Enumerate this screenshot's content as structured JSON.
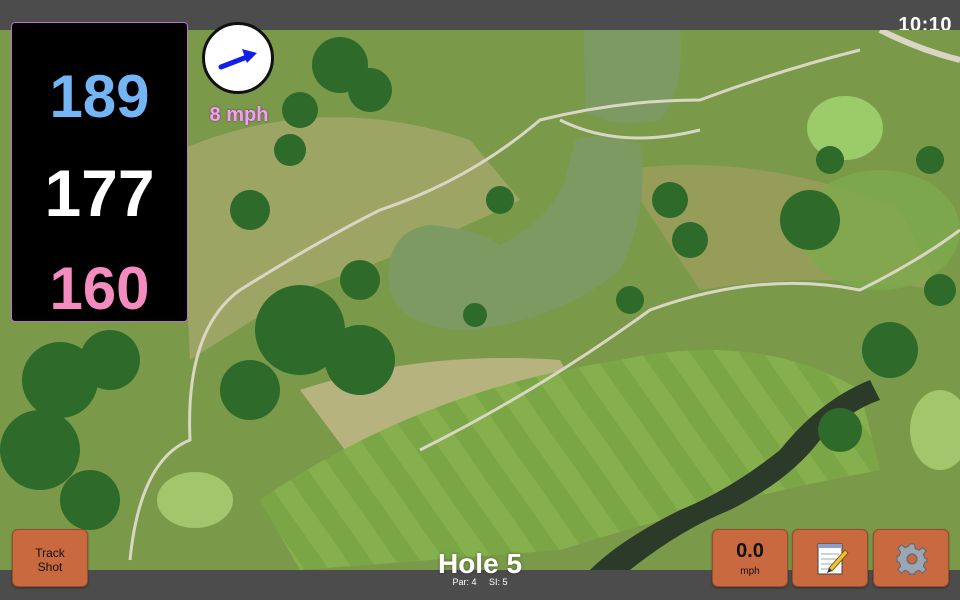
{
  "status": {
    "clock": "10:10"
  },
  "distances": {
    "back": "189",
    "middle": "177",
    "front": "160"
  },
  "wind": {
    "speed_label": "8 mph",
    "direction_icon": "wind-arrow-icon"
  },
  "hole": {
    "title": "Hole 5",
    "par_label": "Par: 4",
    "si_label": "SI: 5"
  },
  "buttons": {
    "track_shot_line1": "Track",
    "track_shot_line2": "Shot",
    "wind_value": "0.0",
    "wind_unit": "mph",
    "notes_icon": "notepad-icon",
    "settings_icon": "gear-icon"
  },
  "colors": {
    "back_distance": "#74b6f5",
    "middle_distance": "#ffffff",
    "front_distance": "#f58cc0",
    "button": "#c8693f",
    "wind_text": "#f0a0ee"
  }
}
